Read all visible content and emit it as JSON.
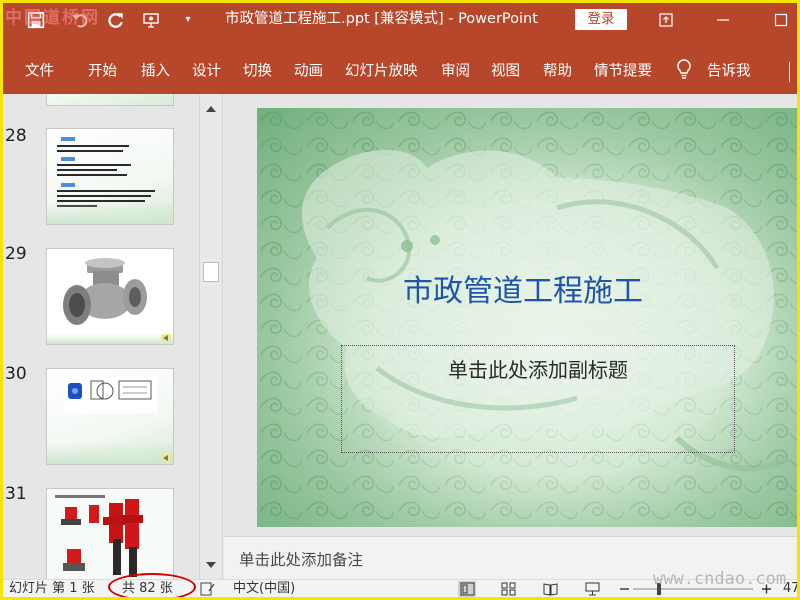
{
  "watermark": "中国道桥网",
  "window": {
    "title": "市政管道工程施工.ppt [兼容模式]  -  PowerPoint",
    "login_label": "登录"
  },
  "quick_access": {
    "icons": [
      "save-icon",
      "undo-icon",
      "redo-icon",
      "present-from-start-icon",
      "customize-toolbar-icon"
    ]
  },
  "ribbon": {
    "tabs": [
      "文件",
      "开始",
      "插入",
      "设计",
      "切换",
      "动画",
      "幻灯片放映",
      "审阅",
      "视图",
      "帮助",
      "情节提要"
    ],
    "tell_me_label": "告诉我"
  },
  "thumbnails": [
    {
      "number": "28"
    },
    {
      "number": "29"
    },
    {
      "number": "30"
    },
    {
      "number": "31"
    }
  ],
  "slide": {
    "title": "市政管道工程施工",
    "subtitle_placeholder": "单击此处添加副标题"
  },
  "notes": {
    "placeholder": "单击此处添加备注"
  },
  "statusbar": {
    "slide_position": "幻灯片 第 1 张",
    "total_slides": "共 82 张",
    "language": "中文(中国)",
    "zoom_label": "47",
    "watermark": "www.cndao.com"
  },
  "colors": {
    "accent": "#b7472a",
    "title_text": "#1f55a8",
    "annotation_circle": "#d10000"
  }
}
